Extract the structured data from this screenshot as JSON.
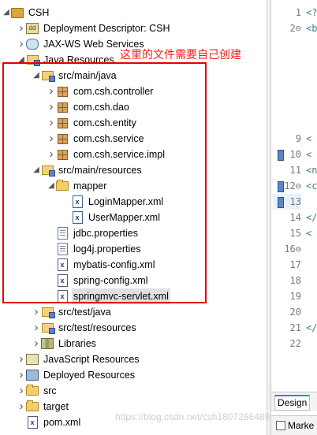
{
  "tree": [
    {
      "label": "CSH",
      "depth": 0,
      "twisty": "open",
      "icon": "project-icon"
    },
    {
      "label": "Deployment Descriptor: CSH",
      "depth": 1,
      "twisty": "closed",
      "icon": "deployment-descriptor-icon"
    },
    {
      "label": "JAX-WS Web Services",
      "depth": 1,
      "twisty": "closed",
      "icon": "web-services-icon"
    },
    {
      "label": "Java Resources",
      "depth": 1,
      "twisty": "open",
      "icon": "java-resources-icon"
    },
    {
      "label": "src/main/java",
      "depth": 2,
      "twisty": "open",
      "icon": "source-folder-icon"
    },
    {
      "label": "com.csh.controller",
      "depth": 3,
      "twisty": "closed",
      "icon": "package-icon"
    },
    {
      "label": "com.csh.dao",
      "depth": 3,
      "twisty": "closed",
      "icon": "package-icon"
    },
    {
      "label": "com.csh.entity",
      "depth": 3,
      "twisty": "closed",
      "icon": "package-icon"
    },
    {
      "label": "com.csh.service",
      "depth": 3,
      "twisty": "closed",
      "icon": "package-icon"
    },
    {
      "label": "com.csh.service.impl",
      "depth": 3,
      "twisty": "closed",
      "icon": "package-icon"
    },
    {
      "label": "src/main/resources",
      "depth": 2,
      "twisty": "open",
      "icon": "source-folder-icon"
    },
    {
      "label": "mapper",
      "depth": 3,
      "twisty": "open",
      "icon": "folder-icon"
    },
    {
      "label": "LoginMapper.xml",
      "depth": 4,
      "twisty": "none",
      "icon": "xml-file-icon"
    },
    {
      "label": "UserMapper.xml",
      "depth": 4,
      "twisty": "none",
      "icon": "xml-file-icon"
    },
    {
      "label": "jdbc.properties",
      "depth": 3,
      "twisty": "none",
      "icon": "properties-file-icon"
    },
    {
      "label": "log4j.properties",
      "depth": 3,
      "twisty": "none",
      "icon": "properties-file-icon"
    },
    {
      "label": "mybatis-config.xml",
      "depth": 3,
      "twisty": "none",
      "icon": "xml-file-icon"
    },
    {
      "label": "spring-config.xml",
      "depth": 3,
      "twisty": "none",
      "icon": "xml-file-icon"
    },
    {
      "label": "springmvc-servlet.xml",
      "depth": 3,
      "twisty": "none",
      "icon": "xml-file-icon",
      "selected": true
    },
    {
      "label": "src/test/java",
      "depth": 2,
      "twisty": "closed",
      "icon": "source-folder-icon"
    },
    {
      "label": "src/test/resources",
      "depth": 2,
      "twisty": "closed",
      "icon": "source-folder-icon"
    },
    {
      "label": "Libraries",
      "depth": 2,
      "twisty": "closed",
      "icon": "library-icon"
    },
    {
      "label": "JavaScript Resources",
      "depth": 1,
      "twisty": "closed",
      "icon": "javascript-resources-icon"
    },
    {
      "label": "Deployed Resources",
      "depth": 1,
      "twisty": "closed",
      "icon": "deployed-resources-icon"
    },
    {
      "label": "src",
      "depth": 1,
      "twisty": "closed",
      "icon": "folder-icon"
    },
    {
      "label": "target",
      "depth": 1,
      "twisty": "closed",
      "icon": "folder-icon"
    },
    {
      "label": "pom.xml",
      "depth": 1,
      "twisty": "none",
      "icon": "xml-file-icon"
    }
  ],
  "annotation": "这里的文件需要自己创建",
  "editor": {
    "lines": [
      {
        "num": "1",
        "code": "<?"
      },
      {
        "num": "2⊖",
        "code": "<b"
      },
      {
        "num": "",
        "code": ""
      },
      {
        "num": "",
        "code": ""
      },
      {
        "num": "",
        "code": ""
      },
      {
        "num": "",
        "code": ""
      },
      {
        "num": "",
        "code": ""
      },
      {
        "num": "",
        "code": ""
      },
      {
        "num": "9",
        "code": "<"
      },
      {
        "num": "10",
        "code": "<"
      },
      {
        "num": "11",
        "code": "<n"
      },
      {
        "num": "12⊖",
        "code": "<c"
      },
      {
        "num": "13",
        "code": ""
      },
      {
        "num": "14",
        "code": "</"
      },
      {
        "num": "15",
        "code": "<"
      },
      {
        "num": "16⊖",
        "code": ""
      },
      {
        "num": "17",
        "code": ""
      },
      {
        "num": "18",
        "code": ""
      },
      {
        "num": "19",
        "code": ""
      },
      {
        "num": "20",
        "code": ""
      },
      {
        "num": "21",
        "code": "</"
      },
      {
        "num": "22",
        "code": ""
      }
    ],
    "design_tab": "Design",
    "markers_tab": "Marke"
  },
  "watermark": "https://blog.csdn.net/csh1807266489"
}
